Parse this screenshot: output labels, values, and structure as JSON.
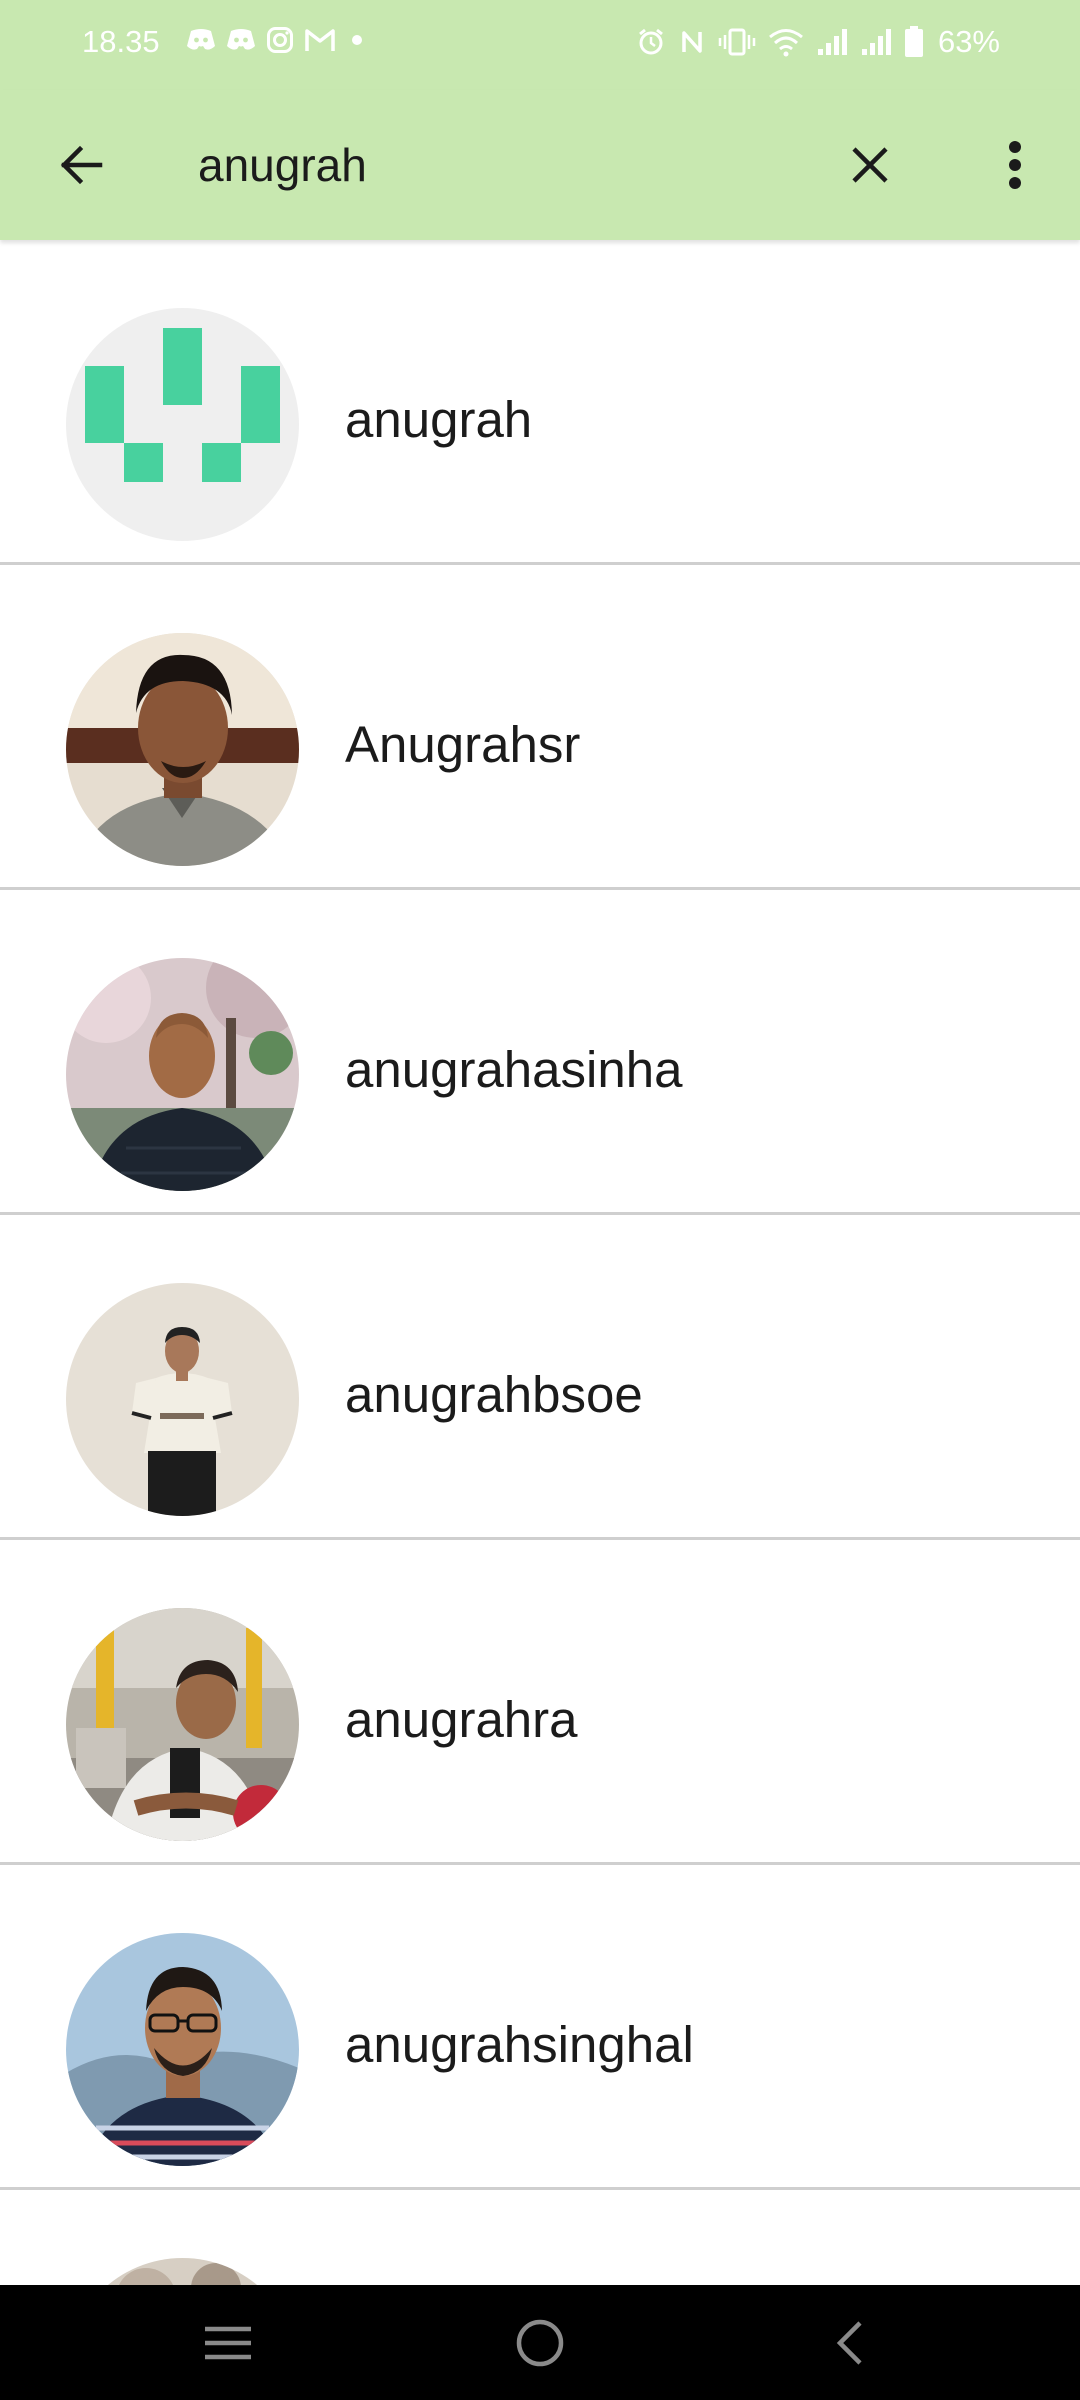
{
  "status_bar": {
    "time": "18.35",
    "battery_percent": "63%",
    "left_icons": [
      "discord-icon",
      "discord-icon",
      "instagram-icon",
      "gmail-icon",
      "dot-icon"
    ],
    "right_icons": [
      "alarm-icon",
      "nfc-icon",
      "vibrate-icon",
      "wifi-icon",
      "signal-icon",
      "signal-icon",
      "battery-icon"
    ]
  },
  "search": {
    "query": "anugrah",
    "back_icon": "arrow-left-icon",
    "clear_icon": "close-icon",
    "more_icon": "more-vertical-icon"
  },
  "results": [
    {
      "name": "anugrah",
      "avatar": "identicon"
    },
    {
      "name": "Anugrahsr",
      "avatar": "photo"
    },
    {
      "name": "anugrahasinha",
      "avatar": "photo"
    },
    {
      "name": "anugrahbsoe",
      "avatar": "photo"
    },
    {
      "name": "anugrahra",
      "avatar": "photo"
    },
    {
      "name": "anugrahsinghal",
      "avatar": "photo"
    }
  ],
  "colors": {
    "app_bar": "#c8e8b0",
    "identicon": "#48d19e",
    "divider": "#cfcfcf",
    "nav_bar": "#000000"
  },
  "nav_bar": {
    "icons": [
      "recent-apps-icon",
      "home-icon",
      "back-icon"
    ]
  }
}
